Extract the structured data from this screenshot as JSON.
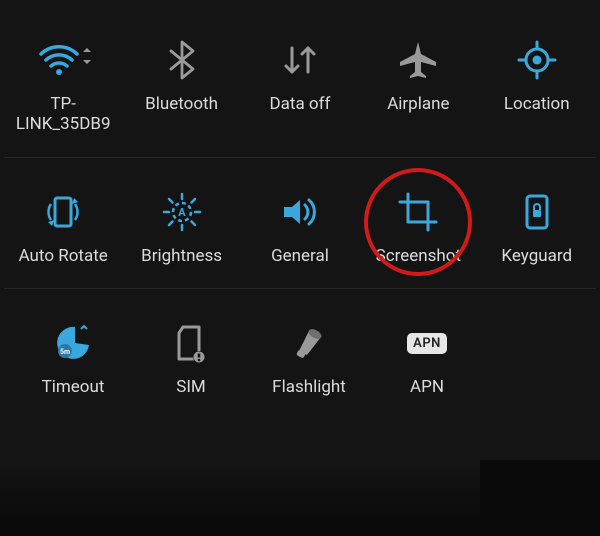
{
  "colors": {
    "accent": "#3aa8dd",
    "muted": "#9a9a9a",
    "text": "#dcdcdc",
    "highlight": "#d11a1a"
  },
  "tiles": {
    "wifi": {
      "label": "TP-\nLINK_35DB9",
      "icon": "wifi-icon"
    },
    "bluetooth": {
      "label": "Bluetooth",
      "icon": "bluetooth-icon"
    },
    "data": {
      "label": "Data off",
      "icon": "data-off-icon"
    },
    "airplane": {
      "label": "Airplane",
      "icon": "airplane-icon"
    },
    "location": {
      "label": "Location",
      "icon": "location-icon"
    },
    "rotate": {
      "label": "Auto Rotate",
      "icon": "rotate-icon"
    },
    "brightness": {
      "label": "Brightness",
      "icon": "brightness-icon"
    },
    "sound": {
      "label": "General",
      "icon": "sound-icon"
    },
    "screenshot": {
      "label": "Screenshot",
      "icon": "screenshot-icon",
      "highlighted": true
    },
    "keyguard": {
      "label": "Keyguard",
      "icon": "keyguard-icon"
    },
    "timeout": {
      "label": "Timeout",
      "icon": "timeout-icon"
    },
    "sim": {
      "label": "SIM",
      "icon": "sim-icon"
    },
    "flashlight": {
      "label": "Flashlight",
      "icon": "flashlight-icon"
    },
    "apn": {
      "label": "APN",
      "icon": "apn-icon",
      "badge": "APN"
    }
  }
}
